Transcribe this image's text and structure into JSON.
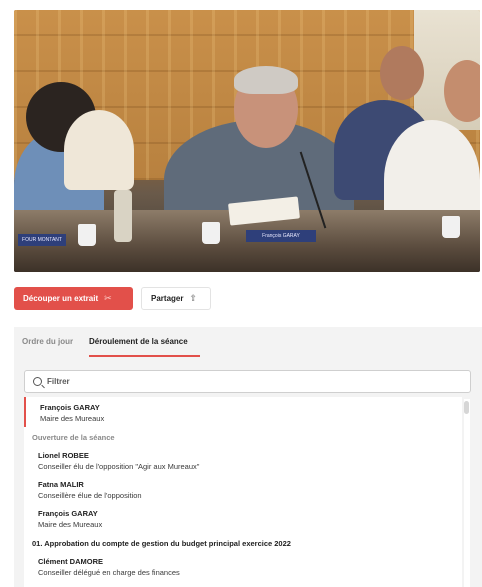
{
  "video": {
    "name_signs": [
      "FOUR MONTANT",
      "François GARAY"
    ]
  },
  "actions": {
    "extract_label": "Découper un extrait",
    "share_label": "Partager"
  },
  "tabs": [
    {
      "label": "Ordre du jour",
      "active": false
    },
    {
      "label": "Déroulement de la séance",
      "active": true
    }
  ],
  "search": {
    "placeholder": "Filtrer",
    "value": ""
  },
  "timeline": [
    {
      "type": "speaker",
      "name": "François GARAY",
      "role": "Maire des Mureaux",
      "current": true
    },
    {
      "type": "section",
      "title": "Ouverture de la séance"
    },
    {
      "type": "speaker",
      "name": "Lionel ROBEE",
      "role": "Conseiller élu de l'opposition \"Agir aux Mureaux\""
    },
    {
      "type": "speaker",
      "name": "Fatna MALIR",
      "role": "Conseillère élue de l'opposition"
    },
    {
      "type": "speaker",
      "name": "François GARAY",
      "role": "Maire des Mureaux"
    },
    {
      "type": "section",
      "title": "01. Approbation du compte de gestion du budget principal exercice 2022"
    },
    {
      "type": "speaker",
      "name": "Clément DAMORE",
      "role": "Conseiller délégué en charge des finances"
    }
  ],
  "colors": {
    "accent": "#e2504a",
    "panel_bg": "#f3f3f3"
  },
  "icons": {
    "extract": "scissors-icon",
    "share": "share-icon",
    "search": "search-icon"
  }
}
